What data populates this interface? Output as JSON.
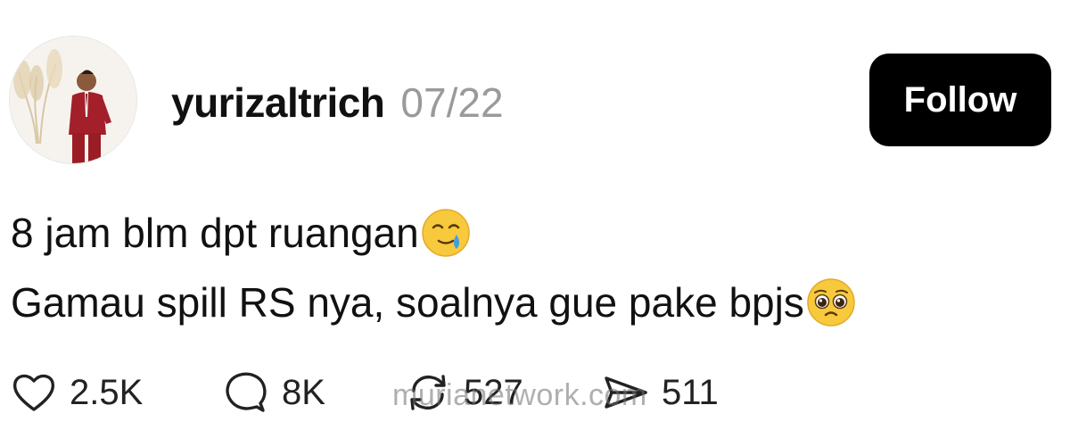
{
  "post": {
    "username": "yurizaltrich",
    "date": "07/22",
    "follow_label": "Follow",
    "lines": [
      {
        "text": "8 jam blm dpt ruangan",
        "emoji": "face-holding-back-tears-icon"
      },
      {
        "text": "Gamau spill RS nya, soalnya gue pake bpjs",
        "emoji": "pleading-face-icon"
      }
    ]
  },
  "actions": {
    "like_count": "2.5K",
    "comment_count": "8K",
    "repost_count": "527",
    "share_count": "511"
  },
  "watermark": "murianetwork.com",
  "colors": {
    "follow_bg": "#000000",
    "follow_text": "#ffffff",
    "date_gray": "#9a9a9a",
    "text": "#111111"
  }
}
